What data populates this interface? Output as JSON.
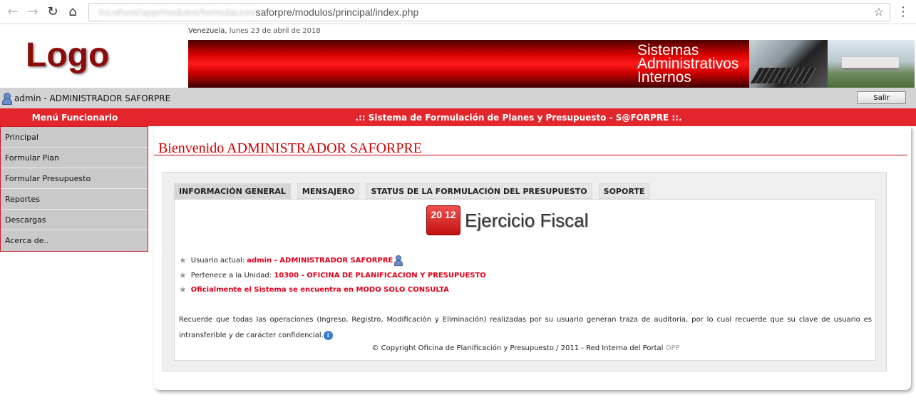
{
  "browser": {
    "back_icon": "arrow-left-icon",
    "forward_icon": "arrow-right-icon",
    "reload_icon": "reload-icon",
    "home_icon": "home-icon",
    "url_blurred": "localhost/app/modulos/formulacion/",
    "url": "saforpre/modulos/principal/index.php",
    "bookmark_icon": "star-icon",
    "menu_icon": "more-vertical-icon"
  },
  "header": {
    "logo": "Logo",
    "date_place": "Venezuela,",
    "date": "lunes 23 de abril de 2018",
    "banner_title": "Sistemas Administrativos Internos"
  },
  "userbar": {
    "user": "admin - ADMINISTRADOR SAFORPRE",
    "logout_label": "Salir"
  },
  "titlebar": {
    "menu_title": "Menú Funcionario",
    "system_title": ".:: Sistema de Formulación de Planes y Presupuesto - S@FORPRE ::."
  },
  "sidebar": {
    "items": [
      {
        "label": "Principal"
      },
      {
        "label": "Formular Plan"
      },
      {
        "label": "Formular Presupuesto"
      },
      {
        "label": "Reportes"
      },
      {
        "label": "Descargas"
      },
      {
        "label": "Acerca de.."
      }
    ]
  },
  "main": {
    "welcome": "Bienvenido ADMINISTRADOR SAFORPRE",
    "tabs": [
      {
        "label": "INFORMACIÓN GENERAL",
        "active": true
      },
      {
        "label": "MENSAJERO"
      },
      {
        "label": "STATUS DE LA FORMULACIÓN DEL PRESUPUESTO"
      },
      {
        "label": "SOPORTE"
      }
    ],
    "fiscal_icon_text": "20 12",
    "fiscal_title": "Ejercicio Fiscal",
    "current_user_label": "Usuario actual:",
    "current_user_value": "admin - ADMINISTRADOR SAFORPRE",
    "unit_label": "Pertenece a la Unidad:",
    "unit_value": "10300 - OFICINA DE PLANIFICACION Y PRESUPUESTO",
    "mode_notice": "Oficialmente el Sistema se encuentra en MODO SOLO CONSULTA",
    "audit_notice": "Recuerde que todas las operaciones (Ingreso, Registro, Modificación y Eliminación) realizadas por su usuario generan traza de auditoría, por lo cual recuerde que su clave de usuario es intransferible y de carácter confidencial.",
    "copyright": "© Copyright Oficina de Planificación y Presupuesto / 2011 - Red Interna del Portal",
    "copyright_link": "OPP"
  },
  "colors": {
    "accent_red": "#e3262c",
    "logo_red": "#8b0a0a",
    "sidebar_bg": "#c9c9c9"
  }
}
